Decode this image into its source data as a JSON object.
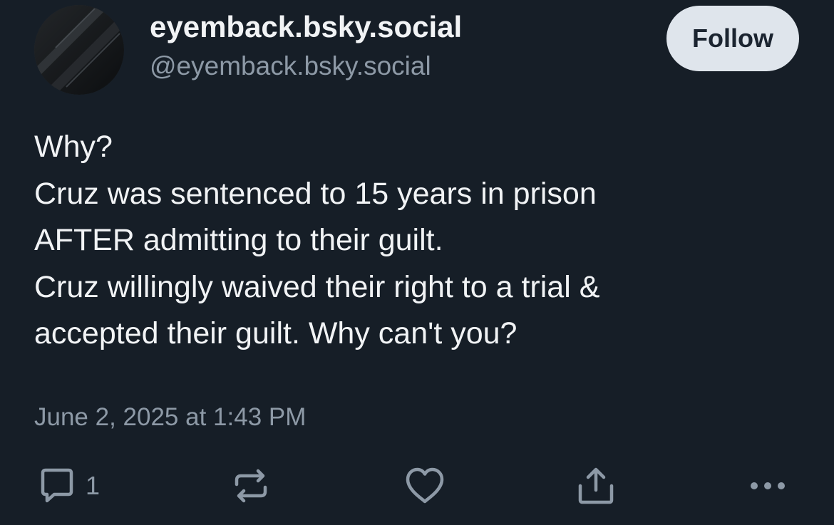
{
  "author": {
    "display_name": "eyemback.bsky.social",
    "handle": "@eyemback.bsky.social"
  },
  "follow_button": {
    "label": "Follow"
  },
  "post": {
    "lines": [
      "Why?",
      "Cruz was sentenced to 15 years in prison",
      "AFTER admitting to their guilt.",
      "Cruz willingly waived their right to a trial &",
      "accepted their guilt. Why can't you?"
    ],
    "timestamp": "June 2, 2025 at 1:43 PM"
  },
  "actions": {
    "reply": {
      "icon": "reply-icon",
      "count": "1"
    },
    "repost": {
      "icon": "repost-icon"
    },
    "like": {
      "icon": "heart-icon"
    },
    "share": {
      "icon": "share-icon"
    },
    "more": {
      "icon": "more-icon"
    }
  },
  "colors": {
    "background": "#161e27",
    "text": "#f1f3f5",
    "muted": "#8d99a6",
    "follow_bg": "#dfe5ec",
    "icon": "#8d99a6"
  }
}
